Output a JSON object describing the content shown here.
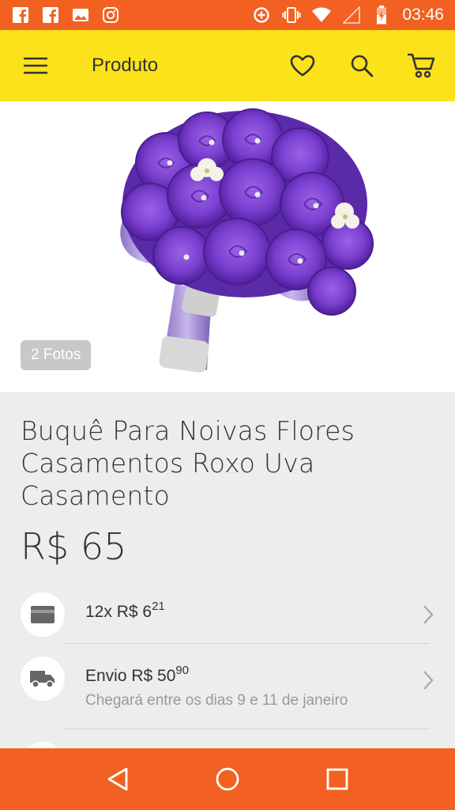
{
  "status_bar": {
    "time": "03:46",
    "icons": [
      "facebook-icon",
      "facebook-icon",
      "image-icon",
      "instagram-icon",
      "data-saver-icon",
      "vibrate-icon",
      "wifi-icon",
      "signal-icon",
      "battery-icon"
    ]
  },
  "app_bar": {
    "title": "Produto",
    "icons": [
      "menu-icon",
      "heart-icon",
      "search-icon",
      "cart-icon"
    ]
  },
  "gallery": {
    "photo_count": "2 Fotos"
  },
  "product": {
    "title": "Buquê Para Noivas Flores Casamentos Roxo Uva Casamento",
    "price": "R$ 65"
  },
  "installments": {
    "prefix": "12x R$ 6",
    "cents": "21"
  },
  "shipping": {
    "prefix": "Envio R$ 50",
    "cents": "90",
    "eta": "Chegará entre os dias 9 e 11 de janeiro"
  },
  "colors": {
    "status_bar": "#f26121",
    "app_bar": "#fbe21b",
    "background": "#ededed",
    "bouquet": "#7b3fd0"
  }
}
